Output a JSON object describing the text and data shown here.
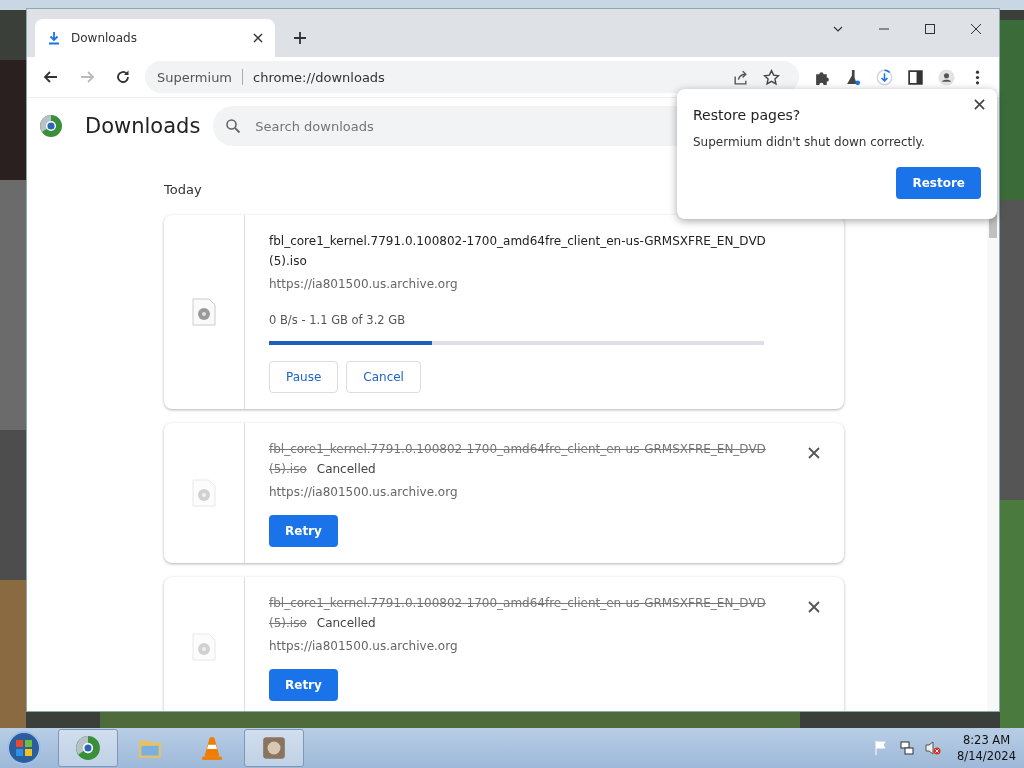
{
  "browser": {
    "tabs": [
      {
        "title": "Downloads",
        "selected": true
      }
    ],
    "address": {
      "site": "Supermium",
      "url": "chrome://downloads"
    }
  },
  "page": {
    "title": "Downloads",
    "search": {
      "placeholder": "Search downloads"
    },
    "section": "Today",
    "downloads": [
      {
        "kind": "active",
        "file_name": "fbl_core1_kernel.7791.0.100802-1700_amd64fre_client_en-us-GRMSXFRE_EN_DVD (5).iso",
        "source": "https://ia801500.us.archive.org",
        "status": "0 B/s - 1.1 GB of 3.2 GB",
        "level": 0.33,
        "buttons": [
          "Pause",
          "Cancel"
        ]
      },
      {
        "kind": "cancelled",
        "file_name": "fbl_core1_kernel.7791.0.100802-1700_amd64fre_client_en-us-GRMSXFRE_EN_DVD (5).iso",
        "status": "Cancelled",
        "source": "https://ia801500.us.archive.org",
        "buttons": [
          "Retry"
        ]
      },
      {
        "kind": "cancelled",
        "file_name": "fbl_core1_kernel.7791.0.100802-1700_amd64fre_client_en-us-GRMSXFRE_EN_DVD (5).iso",
        "status": "Cancelled",
        "source": "https://ia801500.us.archive.org",
        "buttons": [
          "Retry"
        ]
      }
    ]
  },
  "popup": {
    "title": "Restore pages?",
    "message": "Supermium didn't shut down correctly.",
    "button": "Restore"
  },
  "taskbar": {
    "apps": [
      {
        "kind": "browser",
        "selected": true
      },
      {
        "kind": "folder",
        "selected": false
      },
      {
        "kind": "cone",
        "selected": false
      },
      {
        "kind": "game",
        "selected": true
      }
    ],
    "time": "8:23 AM",
    "date": "8/14/2024"
  }
}
